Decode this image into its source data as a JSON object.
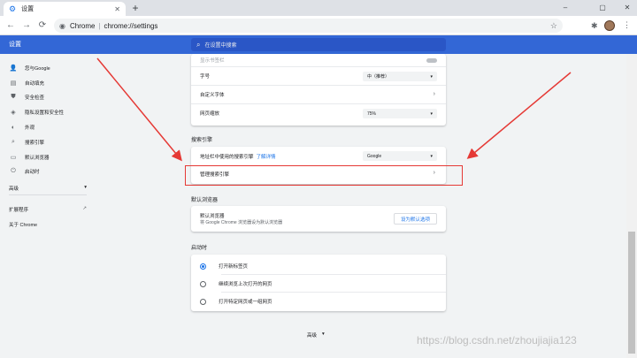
{
  "tab": {
    "title": "设置",
    "close": "✕"
  },
  "newtab": "+",
  "window": {
    "minimize": "–",
    "maximize": "▢",
    "close": "✕"
  },
  "nav": {
    "back": "←",
    "forward": "→",
    "reload": "⟳"
  },
  "omnibox": {
    "site": "Chrome",
    "url": "chrome://settings"
  },
  "header": {
    "title": "设置",
    "search_placeholder": "在设置中搜索"
  },
  "sidebar": {
    "items": [
      {
        "icon": "person-icon",
        "glyph": "👤",
        "label": "您与Google"
      },
      {
        "icon": "autofill-icon",
        "glyph": "▤",
        "label": "自动填充"
      },
      {
        "icon": "shield-icon",
        "glyph": "⛊",
        "label": "安全检查"
      },
      {
        "icon": "privacy-shield-icon",
        "glyph": "◈",
        "label": "隐私设置和安全性"
      },
      {
        "icon": "palette-icon",
        "glyph": "◐",
        "label": "外观"
      },
      {
        "icon": "search-icon",
        "glyph": "⌕",
        "label": "搜索引擎"
      },
      {
        "icon": "browser-icon",
        "glyph": "▭",
        "label": "默认浏览器"
      },
      {
        "icon": "power-icon",
        "glyph": "⏻",
        "label": "启动时"
      }
    ],
    "advanced": "高级",
    "extensions": "扩展程序",
    "about": "关于 Chrome"
  },
  "appearance": {
    "bookmarks_bar": "显示书签栏",
    "font_size_label": "字号",
    "font_size_value": "中（推荐）",
    "custom_fonts": "自定义字体",
    "zoom_label": "网页缩放",
    "zoom_value": "75%"
  },
  "search_engine": {
    "section": "搜索引擎",
    "address_bar_label": "地址栏中使用的搜索引擎",
    "learn_more": "了解详情",
    "engine_value": "Google",
    "manage": "管理搜索引擎"
  },
  "default_browser": {
    "section": "默认浏览器",
    "title": "默认浏览器",
    "desc": "将 Google Chrome 浏览器设为默认浏览器",
    "button": "设为默认选项"
  },
  "startup": {
    "section": "启动时",
    "options": [
      "打开新标签页",
      "继续浏览上次打开的网页",
      "打开特定网页或一组网页"
    ]
  },
  "footer": {
    "advanced": "高级"
  },
  "watermark": "https://blog.csdn.net/zhoujiajia123",
  "colors": {
    "header": "#3367d6",
    "accent": "#1a73e8",
    "annotation": "#e53935"
  }
}
